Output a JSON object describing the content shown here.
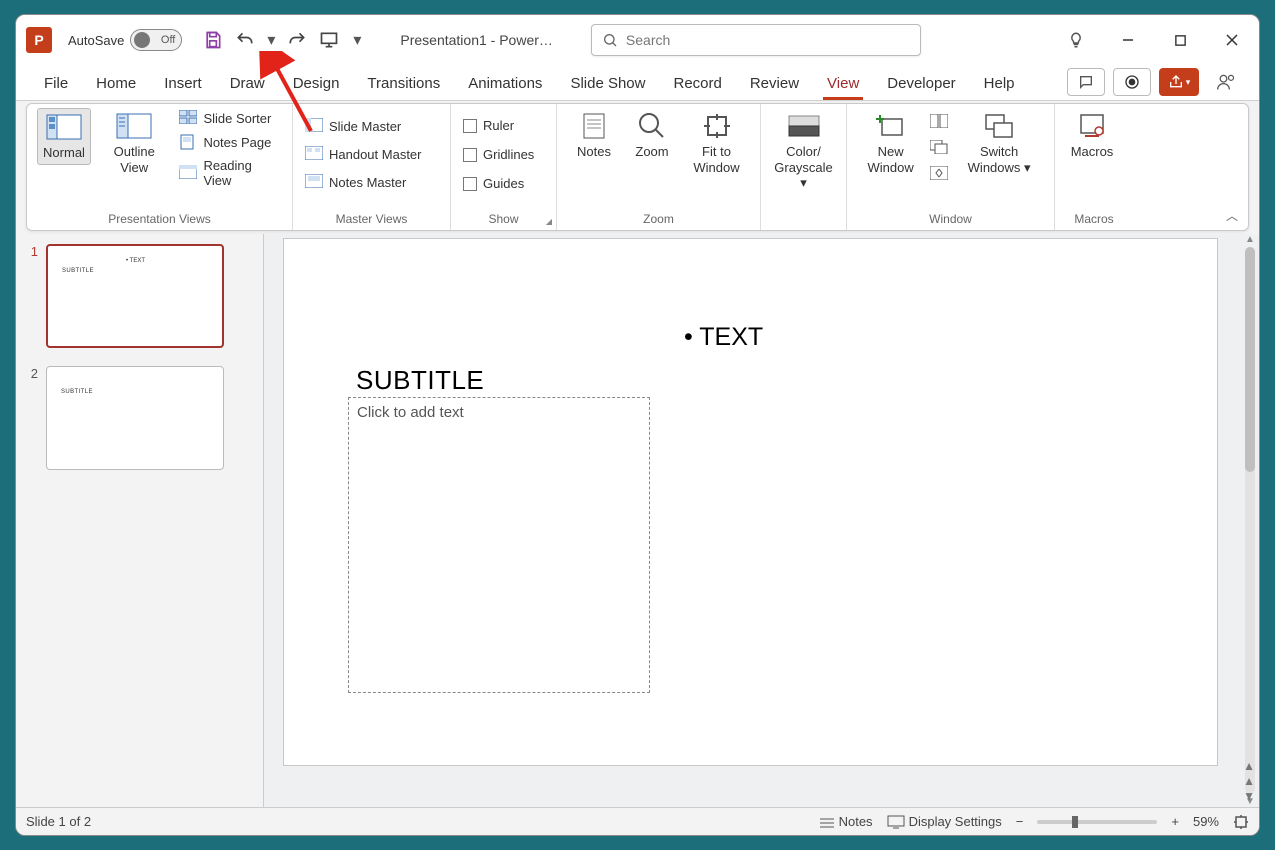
{
  "title": {
    "autosave_label": "AutoSave",
    "autosave_state": "Off",
    "doc_title": "Presentation1  -  Power…"
  },
  "search": {
    "placeholder": "Search"
  },
  "tabs": [
    "File",
    "Home",
    "Insert",
    "Draw",
    "Design",
    "Transitions",
    "Animations",
    "Slide Show",
    "Record",
    "Review",
    "View",
    "Developer",
    "Help"
  ],
  "active_tab": "View",
  "ribbon": {
    "presentation_views": {
      "label": "Presentation Views",
      "normal": "Normal",
      "outline": "Outline View",
      "slide_sorter": "Slide Sorter",
      "notes_page": "Notes Page",
      "reading_view": "Reading View"
    },
    "master_views": {
      "label": "Master Views",
      "slide_master": "Slide Master",
      "handout_master": "Handout Master",
      "notes_master": "Notes Master"
    },
    "show": {
      "label": "Show",
      "ruler": "Ruler",
      "gridlines": "Gridlines",
      "guides": "Guides"
    },
    "zoom": {
      "label": "Zoom",
      "notes": "Notes",
      "zoom": "Zoom",
      "fit": "Fit to Window"
    },
    "color": {
      "label": "Color/ Grayscale"
    },
    "window": {
      "label": "Window",
      "new": "New Window",
      "switch": "Switch Windows"
    },
    "macros": {
      "label": "Macros",
      "btn": "Macros"
    }
  },
  "thumbs": {
    "slide1": {
      "num": "1",
      "subtitle": "SUBTITLE",
      "text": "• TEXT"
    },
    "slide2": {
      "num": "2",
      "subtitle": "SUBTITLE"
    }
  },
  "slide": {
    "subtitle": "SUBTITLE",
    "bullet": "TEXT",
    "placeholder": "Click to add text"
  },
  "status": {
    "slide_info": "Slide 1 of 2",
    "notes": "Notes",
    "display": "Display Settings",
    "zoom_pct": "59%"
  }
}
